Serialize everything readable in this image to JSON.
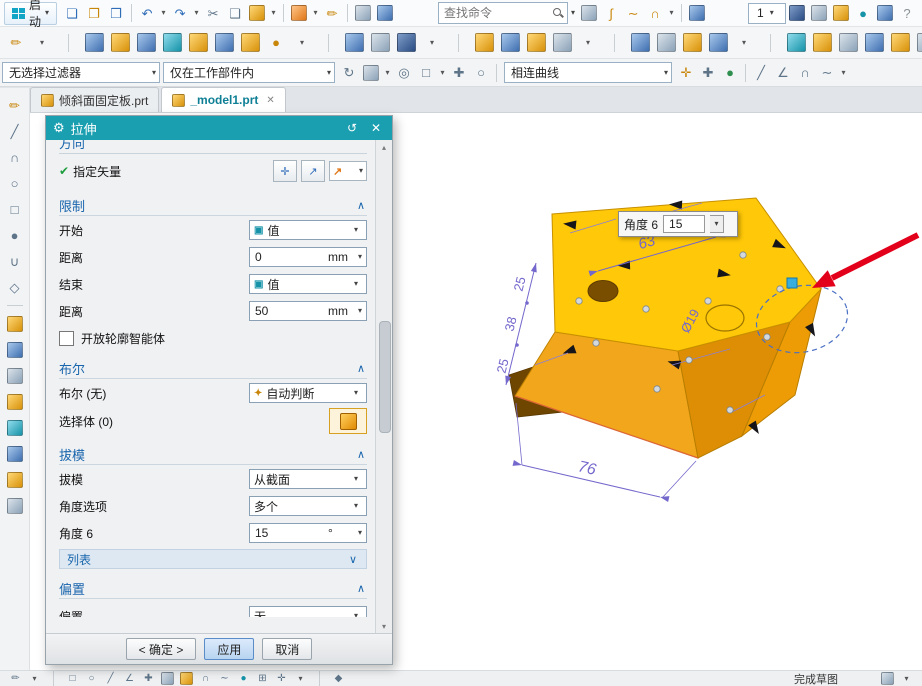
{
  "app": {
    "start_label": "启动",
    "find_placeholder": "查找命令",
    "zoom_value": "1"
  },
  "glyphs": {
    "caret_down": "▾",
    "caret_up": "▴",
    "chev_collapse": "∧",
    "chev_expand": "∨",
    "check": "✔",
    "gear": "⚙",
    "reset": "↺",
    "close": "✕",
    "crosshair": "✛",
    "vector_arrow": "↗",
    "value_icon": "▣",
    "inferred_icon": "✦"
  },
  "toolbars": {
    "row1_left": [
      {
        "name": "new-file-icon",
        "kind": "glyph",
        "glyph": "❏",
        "tone": "blue"
      },
      {
        "name": "open-file-icon",
        "kind": "glyph",
        "glyph": "❐",
        "tone": "gold"
      },
      {
        "name": "save-icon",
        "kind": "glyph",
        "glyph": "❒",
        "tone": "blue"
      },
      {
        "name": "separator",
        "kind": "sep"
      },
      {
        "name": "undo-icon",
        "kind": "glyph",
        "glyph": "↶",
        "tone": "blue"
      },
      {
        "name": "undo-caret-icon",
        "kind": "caret",
        "glyph": "▾"
      },
      {
        "name": "redo-icon",
        "kind": "glyph",
        "glyph": "↷",
        "tone": "blue"
      },
      {
        "name": "redo-caret-icon",
        "kind": "caret",
        "glyph": "▾"
      },
      {
        "name": "cut-icon",
        "kind": "glyph",
        "glyph": "✂",
        "tone": "steel"
      },
      {
        "name": "copy-icon",
        "kind": "glyph",
        "glyph": "❑",
        "tone": "steel"
      },
      {
        "name": "paste-icon",
        "kind": "cube",
        "tone": "gold"
      },
      {
        "name": "paste-caret-icon",
        "kind": "caret",
        "glyph": "▾"
      },
      {
        "name": "separator",
        "kind": "sep"
      },
      {
        "name": "wcs-cube-icon",
        "kind": "cube",
        "tone": "orange"
      },
      {
        "name": "wcs-caret-icon",
        "kind": "caret",
        "glyph": "▾"
      },
      {
        "name": "edit-object-icon",
        "kind": "glyph",
        "glyph": "✏",
        "tone": "gold"
      },
      {
        "name": "separator",
        "kind": "sep"
      },
      {
        "name": "view-tool-icon",
        "kind": "cube",
        "tone": "steel"
      },
      {
        "name": "render-tool-icon",
        "kind": "cube",
        "tone": "blue"
      }
    ],
    "row1_mid": [
      {
        "name": "touch-mode-icon",
        "kind": "cube",
        "tone": "steel"
      },
      {
        "name": "spline-icon",
        "kind": "glyph",
        "glyph": "∫",
        "tone": "gold"
      },
      {
        "name": "studio-curve-icon",
        "kind": "glyph",
        "glyph": "∼",
        "tone": "gold"
      },
      {
        "name": "arc-tool-icon",
        "kind": "glyph",
        "glyph": "∩",
        "tone": "gold"
      },
      {
        "name": "curve-caret-icon",
        "kind": "caret",
        "glyph": "▾"
      },
      {
        "name": "separator",
        "kind": "sep"
      },
      {
        "name": "datum-tool-icon",
        "kind": "cube",
        "tone": "blue"
      }
    ],
    "row1_right": [
      {
        "name": "view-cube-icon",
        "kind": "cube",
        "tone": "navy"
      },
      {
        "name": "shade-mode-icon",
        "kind": "cube",
        "tone": "steel"
      },
      {
        "name": "material-icon",
        "kind": "cube",
        "tone": "gold"
      },
      {
        "name": "sphere-view-icon",
        "kind": "glyph",
        "glyph": "●",
        "tone": "teal"
      },
      {
        "name": "window-icon",
        "kind": "cube",
        "tone": "blue"
      },
      {
        "name": "help-icon",
        "kind": "glyph",
        "glyph": "?",
        "tone": "gray"
      }
    ],
    "row2": [
      {
        "name": "direct-sketch-icon",
        "kind": "glyph",
        "glyph": "✏",
        "tone": "gold"
      },
      {
        "name": "sketch-caret-icon",
        "kind": "caret",
        "glyph": "▾"
      },
      {
        "name": "separator",
        "kind": "sep"
      },
      {
        "name": "datum-plane-icon",
        "kind": "cube",
        "tone": "blue"
      },
      {
        "name": "extrude-icon",
        "kind": "cube",
        "tone": "gold"
      },
      {
        "name": "revolve-icon",
        "kind": "cube",
        "tone": "blue"
      },
      {
        "name": "hole-icon",
        "kind": "cube",
        "tone": "teal"
      },
      {
        "name": "block-icon",
        "kind": "cube",
        "tone": "gold"
      },
      {
        "name": "cylinder-icon",
        "kind": "cube",
        "tone": "blue"
      },
      {
        "name": "cone-icon",
        "kind": "cube",
        "tone": "gold"
      },
      {
        "name": "sphere-icon",
        "kind": "glyph",
        "glyph": "●",
        "tone": "gold"
      },
      {
        "name": "primitive-caret-icon",
        "kind": "caret",
        "glyph": "▾"
      },
      {
        "name": "separator",
        "kind": "sep"
      },
      {
        "name": "unite-icon",
        "kind": "cube",
        "tone": "blue"
      },
      {
        "name": "subtract-icon",
        "kind": "cube",
        "tone": "steel"
      },
      {
        "name": "intersect-icon",
        "kind": "cube",
        "tone": "navy"
      },
      {
        "name": "boolean-caret-icon",
        "kind": "caret",
        "glyph": "▾"
      },
      {
        "name": "separator",
        "kind": "sep"
      },
      {
        "name": "edge-blend-icon",
        "kind": "cube",
        "tone": "gold"
      },
      {
        "name": "chamfer-icon",
        "kind": "cube",
        "tone": "blue"
      },
      {
        "name": "draft-feature-icon",
        "kind": "cube",
        "tone": "gold"
      },
      {
        "name": "shell-icon",
        "kind": "cube",
        "tone": "steel"
      },
      {
        "name": "blend-caret-icon",
        "kind": "caret",
        "glyph": "▾"
      },
      {
        "name": "separator",
        "kind": "sep"
      },
      {
        "name": "trim-body-icon",
        "kind": "cube",
        "tone": "blue"
      },
      {
        "name": "split-body-icon",
        "kind": "cube",
        "tone": "steel"
      },
      {
        "name": "pattern-feature-icon",
        "kind": "cube",
        "tone": "gold"
      },
      {
        "name": "mirror-feature-icon",
        "kind": "cube",
        "tone": "blue"
      },
      {
        "name": "pattern-caret-icon",
        "kind": "caret",
        "glyph": "▾"
      },
      {
        "name": "separator",
        "kind": "sep"
      },
      {
        "name": "offset-face-icon",
        "kind": "cube",
        "tone": "teal"
      },
      {
        "name": "thicken-icon",
        "kind": "cube",
        "tone": "gold"
      },
      {
        "name": "thread-icon",
        "kind": "cube",
        "tone": "steel"
      },
      {
        "name": "tube-icon",
        "kind": "cube",
        "tone": "blue"
      },
      {
        "name": "sweep-icon",
        "kind": "cube",
        "tone": "gold"
      },
      {
        "name": "emboss-icon",
        "kind": "cube",
        "tone": "steel"
      },
      {
        "name": "wrap-icon",
        "kind": "cube",
        "tone": "blue"
      },
      {
        "name": "sew-icon",
        "kind": "cube",
        "tone": "teal"
      },
      {
        "name": "more-caret-icon",
        "kind": "caret",
        "glyph": "▾"
      }
    ]
  },
  "filter_bar": {
    "selection_filter": "无选择过滤器",
    "scope": "仅在工作部件内",
    "curve_rule": "相连曲线",
    "icons_a": [
      {
        "name": "refresh-icon",
        "kind": "glyph",
        "glyph": "↻",
        "tone": "steel"
      },
      {
        "name": "snapshot-icon",
        "kind": "cube",
        "tone": "steel"
      },
      {
        "name": "snapshot-caret-icon",
        "kind": "caret",
        "glyph": "▾"
      },
      {
        "name": "target-icon",
        "kind": "glyph",
        "glyph": "◎",
        "tone": "steel"
      },
      {
        "name": "select-rect-icon",
        "kind": "glyph",
        "glyph": "□",
        "tone": "steel"
      },
      {
        "name": "select-caret-icon",
        "kind": "caret",
        "glyph": "▾"
      },
      {
        "name": "plus-select-icon",
        "kind": "glyph",
        "glyph": "✚",
        "tone": "steel"
      },
      {
        "name": "circle-select-icon",
        "kind": "glyph",
        "glyph": "○",
        "tone": "steel"
      },
      {
        "name": "separator",
        "kind": "sep"
      }
    ],
    "icons_b": [
      {
        "name": "snap-point-icon",
        "kind": "glyph",
        "glyph": "✛",
        "tone": "gold"
      },
      {
        "name": "snap-midpoint-icon",
        "kind": "glyph",
        "glyph": "✚",
        "tone": "steel"
      },
      {
        "name": "snap-end-icon",
        "kind": "glyph",
        "glyph": "●",
        "tone": "green"
      },
      {
        "name": "separator",
        "kind": "sep"
      },
      {
        "name": "line-snap-icon",
        "kind": "glyph",
        "glyph": "╱",
        "tone": "steel"
      },
      {
        "name": "angle-snap-icon",
        "kind": "glyph",
        "glyph": "∠",
        "tone": "steel"
      },
      {
        "name": "arc-snap-icon",
        "kind": "glyph",
        "glyph": "∩",
        "tone": "steel"
      },
      {
        "name": "curve-snap-icon",
        "kind": "glyph",
        "glyph": "∼",
        "tone": "steel"
      },
      {
        "name": "snap-caret-icon",
        "kind": "caret",
        "glyph": "▾"
      }
    ]
  },
  "tabs": {
    "tab1_label": "倾斜面固定板.prt",
    "tab2_label": "_model1.prt"
  },
  "sidebar_icons": [
    {
      "name": "profile-icon",
      "kind": "glyph",
      "glyph": "✏",
      "tone": "gold"
    },
    {
      "name": "line-icon",
      "kind": "glyph",
      "glyph": "╱",
      "tone": "steel"
    },
    {
      "name": "arc-icon",
      "kind": "glyph",
      "glyph": "∩",
      "tone": "steel"
    },
    {
      "name": "circle-icon",
      "kind": "glyph",
      "glyph": "○",
      "tone": "steel"
    },
    {
      "name": "rectangle-icon",
      "kind": "glyph",
      "glyph": "□",
      "tone": "steel"
    },
    {
      "name": "point-icon",
      "kind": "glyph",
      "glyph": "●",
      "tone": "steel"
    },
    {
      "name": "fillet-icon",
      "kind": "glyph",
      "glyph": "∪",
      "tone": "steel"
    },
    {
      "name": "polygon-icon",
      "kind": "glyph",
      "glyph": "◇",
      "tone": "steel"
    },
    {
      "name": "separator",
      "kind": "sep"
    },
    {
      "name": "extrude-mini-icon",
      "kind": "cube",
      "tone": "gold"
    },
    {
      "name": "revolve-mini-icon",
      "kind": "cube",
      "tone": "blue"
    },
    {
      "name": "sweep-mini-icon",
      "kind": "cube",
      "tone": "steel"
    },
    {
      "name": "blend-mini-icon",
      "kind": "cube",
      "tone": "gold"
    },
    {
      "name": "hole-mini-icon",
      "kind": "cube",
      "tone": "teal"
    },
    {
      "name": "boss-mini-icon",
      "kind": "cube",
      "tone": "blue"
    },
    {
      "name": "pocket-mini-icon",
      "kind": "cube",
      "tone": "gold"
    },
    {
      "name": "pad-mini-icon",
      "kind": "cube",
      "tone": "steel"
    }
  ],
  "dialog": {
    "title": "拉伸",
    "direction": {
      "header": "方向",
      "vector_label": "指定矢量"
    },
    "limits": {
      "header": "限制",
      "start_label": "开始",
      "start_mode": "值",
      "dist1_label": "距离",
      "dist1_value": "0",
      "dist1_unit": "mm",
      "end_label": "结束",
      "end_mode": "值",
      "dist2_label": "距离",
      "dist2_value": "50",
      "dist2_unit": "mm",
      "open_profile": "开放轮廓智能体"
    },
    "boolean": {
      "header": "布尔",
      "bool_label": "布尔 (无)",
      "bool_value": "自动判断",
      "select_body": "选择体 (0)"
    },
    "draft": {
      "header": "拔模",
      "draft_label": "拔模",
      "draft_value": "从截面",
      "angle_opt_label": "角度选项",
      "angle_opt_value": "多个",
      "angle_label": "角度 6",
      "angle_value": "15",
      "angle_unit": "°",
      "list_label": "列表"
    },
    "offset": {
      "header": "偏置",
      "offset_label": "偏置",
      "offset_value": "无"
    },
    "footer": {
      "ok": "< 确定 >",
      "apply": "应用",
      "cancel": "取消"
    }
  },
  "viewport": {
    "angle_tip_label": "角度 6",
    "angle_tip_value": "15",
    "dims": {
      "top_width": "63",
      "front_width": "76",
      "seg_a": "25",
      "seg_b": "38",
      "seg_c": "25",
      "diameter": "Ø19"
    }
  },
  "statusbar": {
    "hint": "完成草图",
    "icons_left": [
      {
        "name": "sketch-tool-icon",
        "kind": "glyph",
        "glyph": "✏",
        "tone": "steel"
      },
      {
        "name": "sketch-tool-caret-icon",
        "kind": "caret",
        "glyph": "▾"
      },
      {
        "name": "separator",
        "kind": "sep"
      },
      {
        "name": "rect-tool-icon",
        "kind": "glyph",
        "glyph": "□",
        "tone": "steel"
      },
      {
        "name": "circle-tool-icon",
        "kind": "glyph",
        "glyph": "○",
        "tone": "steel"
      },
      {
        "name": "line-tool-icon",
        "kind": "glyph",
        "glyph": "╱",
        "tone": "steel"
      },
      {
        "name": "angle-tool-icon",
        "kind": "glyph",
        "glyph": "∠",
        "tone": "steel"
      },
      {
        "name": "plus-tool-icon",
        "kind": "glyph",
        "glyph": "✚",
        "tone": "steel"
      }
    ],
    "icons_mid": [
      {
        "name": "constraint-icon",
        "kind": "cube",
        "tone": "steel"
      },
      {
        "name": "dimension-icon",
        "kind": "cube",
        "tone": "gold"
      },
      {
        "name": "arc-mini-icon",
        "kind": "glyph",
        "glyph": "∩",
        "tone": "steel"
      },
      {
        "name": "spline-mini-icon",
        "kind": "glyph",
        "glyph": "∼",
        "tone": "steel"
      },
      {
        "name": "point-mini-icon",
        "kind": "glyph",
        "glyph": "●",
        "tone": "teal"
      },
      {
        "name": "grid-icon",
        "kind": "glyph",
        "glyph": "⊞",
        "tone": "steel"
      },
      {
        "name": "snap-mini-icon",
        "kind": "glyph",
        "glyph": "✛",
        "tone": "steel"
      },
      {
        "name": "mini-caret-icon",
        "kind": "caret",
        "glyph": "▾"
      },
      {
        "name": "separator",
        "kind": "sep"
      },
      {
        "name": "diamond-mini-icon",
        "kind": "glyph",
        "glyph": "◆",
        "tone": "steel"
      }
    ],
    "icons_right": [
      {
        "name": "status-cube-icon",
        "kind": "cube",
        "tone": "steel"
      },
      {
        "name": "status-caret-icon",
        "kind": "caret",
        "glyph": "▾"
      }
    ]
  }
}
